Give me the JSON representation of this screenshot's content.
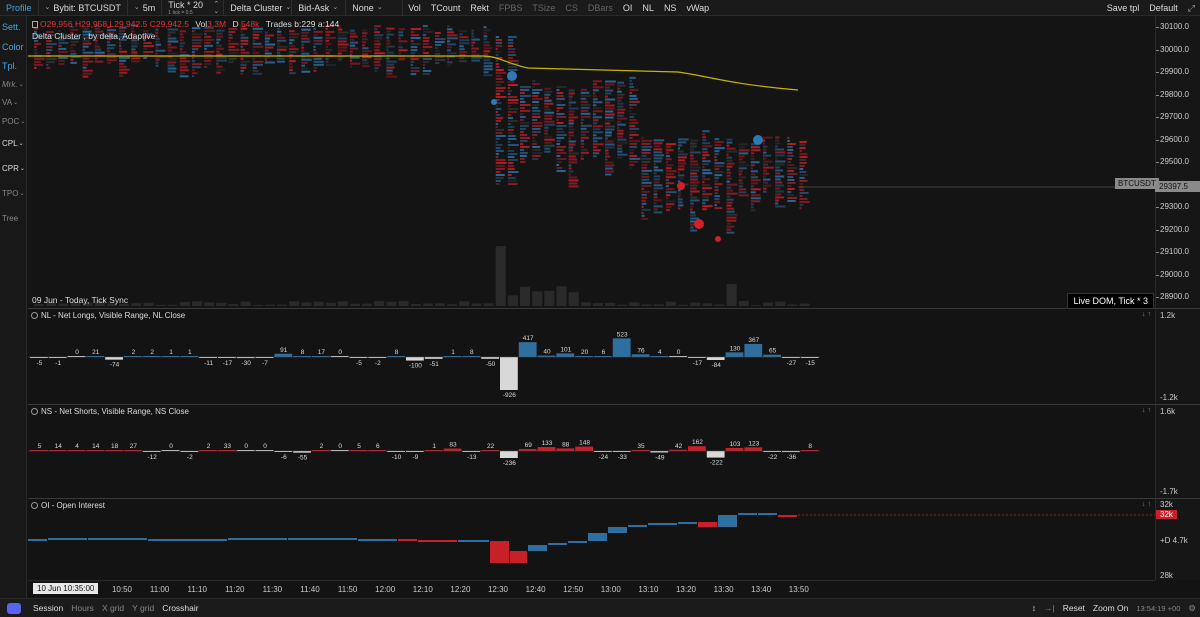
{
  "toolbar": {
    "profile": "Profile",
    "symbol": "Bybit: BTCUSDT",
    "timeframe": "5m",
    "tick": "Tick * 20",
    "tick_sub": "1 tick = 0.5",
    "cluster": "Delta Cluster",
    "mode": "Bid-Ask",
    "filter": "None",
    "buttons": [
      "Vol",
      "TCount",
      "Rekt",
      "FPBS",
      "TSize",
      "CS",
      "DBars",
      "OI",
      "NL",
      "NS",
      "vWap"
    ],
    "save_tpl": "Save tpl",
    "default": "Default"
  },
  "sidebar": {
    "items": [
      "Sett.",
      "Color",
      "Tpl.",
      "Mrk.",
      "VA",
      "POC",
      "CPL",
      "CPR",
      "TPO",
      "Tree"
    ]
  },
  "chart": {
    "ohlc": {
      "o": "O29,956",
      "h": "H29,958",
      "l": "L29,942.5",
      "c": "C29,942.5",
      "vol_label": "Vol",
      "vol": "3.3M",
      "d_label": "D",
      "d": "548k",
      "trades": "Trades b:229 a:144"
    },
    "indicator": "Delta Cluster , by delta, Adaptive",
    "date": "09 Jun  - Today, Tick Sync",
    "dom_badge": "Live DOM, Tick * 3",
    "symbol_badge": "BTCUSDT",
    "last_price": "29397.5",
    "price_ticks": [
      "30100.0",
      "30000.0",
      "29900.0",
      "29800.0",
      "29700.0",
      "29600.0",
      "29500.0",
      "29400.0",
      "29300.0",
      "29200.0",
      "29100.0",
      "29000.0",
      "28900.0"
    ],
    "colors": {
      "vwap": "#c8b400",
      "buy": "#2f79b5",
      "sell": "#d0202a"
    }
  },
  "panes": {
    "nl": {
      "title": "NL - Net Longs, Visible Range, NL Close",
      "axis_top": "1.2k",
      "axis_bottom": "-1.2k",
      "values": [
        -5,
        -1,
        0,
        21,
        -74,
        2,
        2,
        1,
        1,
        -11,
        -17,
        -30,
        -7,
        91,
        8,
        17,
        0,
        -5,
        -2,
        8,
        -100,
        -51,
        1,
        8,
        -50,
        -926,
        417,
        40,
        101,
        20,
        6,
        523,
        76,
        4,
        0,
        -17,
        -84,
        130,
        367,
        65,
        -27,
        -15
      ]
    },
    "ns": {
      "title": "NS - Net Shorts, Visible Range, NS Close",
      "axis_top": "1.6k",
      "axis_bottom": "-1.7k",
      "values": [
        5,
        14,
        4,
        14,
        18,
        27,
        -12,
        0,
        -2,
        2,
        33,
        0,
        0,
        -6,
        -55,
        2,
        0,
        5,
        6,
        -10,
        -9,
        1,
        83,
        -13,
        22,
        -236,
        69,
        133,
        88,
        148,
        -24,
        -33,
        35,
        -49,
        42,
        162,
        -222,
        103,
        123,
        -22,
        -36,
        8
      ]
    },
    "oi": {
      "title": "OI - Open Interest",
      "axis_top": "32k",
      "badge": "32k",
      "axis_mid": "+D 4.7k",
      "axis_bottom": "28k"
    }
  },
  "time_axis": {
    "start": "10 Jun 10:35:00",
    "labels": [
      "10:50",
      "11:00",
      "11:10",
      "11:20",
      "11:30",
      "11:40",
      "11:50",
      "12:00",
      "12:10",
      "12:20",
      "12:30",
      "12:40",
      "12:50",
      "13:00",
      "13:10",
      "13:20",
      "13:30",
      "13:40",
      "13:50"
    ]
  },
  "bottombar": {
    "items": [
      "Session",
      "Hours",
      "X grid",
      "Y grid",
      "Crosshair"
    ],
    "reset": "Reset",
    "zoom_on": "Zoom On",
    "clock": "13:54:19 +00"
  }
}
